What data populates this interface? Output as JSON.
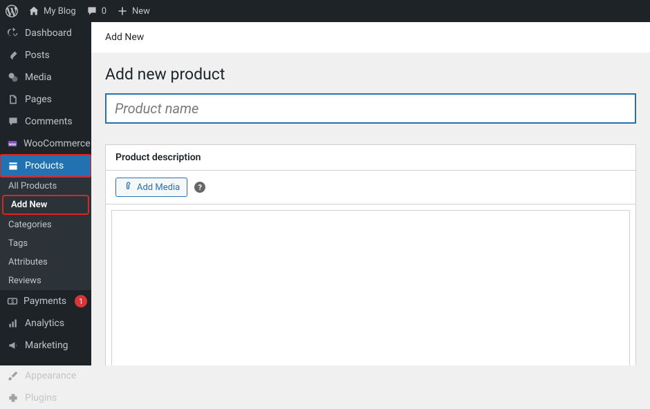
{
  "topbar": {
    "site_name": "My Blog",
    "comments_count": "0",
    "new_label": "New"
  },
  "sidebar": {
    "dashboard": "Dashboard",
    "posts": "Posts",
    "media": "Media",
    "pages": "Pages",
    "comments": "Comments",
    "woocommerce": "WooCommerce",
    "products": "Products",
    "payments": "Payments",
    "payments_badge": "1",
    "analytics": "Analytics",
    "marketing": "Marketing",
    "appearance": "Appearance",
    "plugins": "Plugins"
  },
  "products_submenu": {
    "all_products": "All Products",
    "add_new": "Add New",
    "categories": "Categories",
    "tags": "Tags",
    "attributes": "Attributes",
    "reviews": "Reviews"
  },
  "content": {
    "breadcrumb": "Add New",
    "page_title": "Add new product",
    "title_placeholder": "Product name",
    "description_heading": "Product description",
    "add_media_label": "Add Media",
    "help_char": "?"
  }
}
